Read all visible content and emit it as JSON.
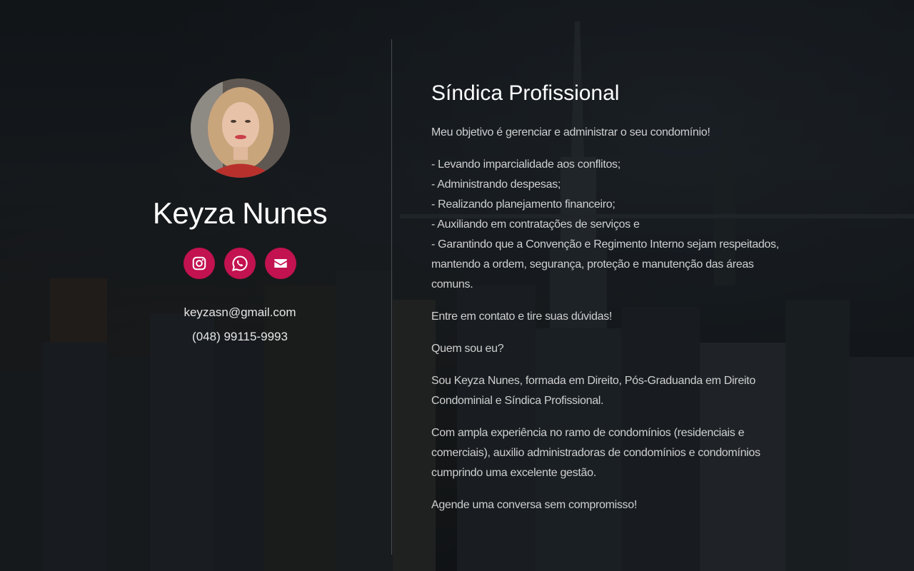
{
  "profile": {
    "name": "Keyza Nunes",
    "email": "keyzasn@gmail.com",
    "phone": "(048) 99115-9993",
    "socials": [
      {
        "icon": "instagram-icon"
      },
      {
        "icon": "whatsapp-icon"
      },
      {
        "icon": "envelope-icon"
      }
    ],
    "accent_color": "#c2124f"
  },
  "content": {
    "title": "Síndica Profissional",
    "objective": "Meu objetivo é gerenciar e administrar o seu condomínio!",
    "list": [
      "- Levando imparcialidade aos conflitos;",
      "- Administrando despesas;",
      "- Realizando planejamento financeiro;",
      "- Auxiliando em contratações de serviços e",
      "- Garantindo que a Convenção e Regimento Interno sejam respeitados, mantendo a ordem, segurança, proteção e manutenção das áreas comuns."
    ],
    "contact_cta": "Entre em contato e tire suas dúvidas!",
    "who_heading": "Quem sou eu?",
    "about": "Sou Keyza Nunes, formada em Direito, Pós-Graduanda em Direito Condominial e Síndica Profissional.",
    "experience": "Com ampla experiência no ramo de condomínios (residenciais e comerciais), auxilio administradoras de condomínios e condomínios cumprindo uma excelente gestão.",
    "closing": "Agende uma conversa sem compromisso!"
  }
}
